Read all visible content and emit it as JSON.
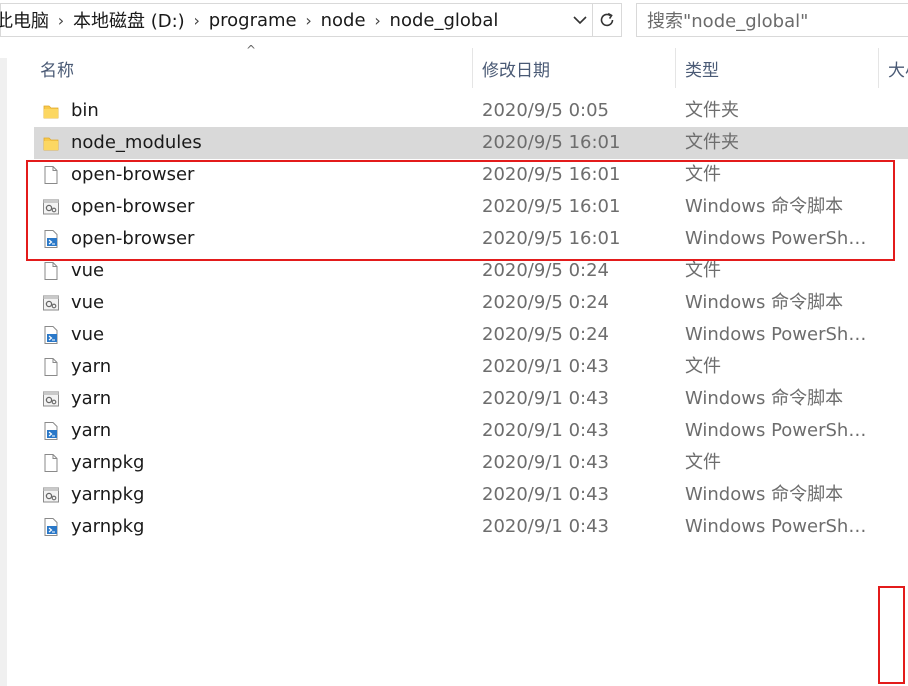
{
  "breadcrumb": {
    "items": [
      "此电脑",
      "本地磁盘 (D:)",
      "programe",
      "node",
      "node_global"
    ],
    "dropdown_icon": "chevron-down-icon",
    "refresh_icon": "refresh-icon"
  },
  "search": {
    "placeholder": "搜索\"node_global\""
  },
  "columns": {
    "name": "名称",
    "date": "修改日期",
    "type": "类型",
    "size": "大小"
  },
  "colors": {
    "highlight": "#e31b1b",
    "selected_row": "#d9d9d9",
    "folder": "#f8c94b"
  },
  "files": [
    {
      "name": "bin",
      "date": "2020/9/5 0:05",
      "type": "文件夹",
      "icon": "folder-icon"
    },
    {
      "name": "node_modules",
      "date": "2020/9/5 16:01",
      "type": "文件夹",
      "icon": "folder-icon",
      "selected": true
    },
    {
      "name": "open-browser",
      "date": "2020/9/5 16:01",
      "type": "文件",
      "icon": "file-icon"
    },
    {
      "name": "open-browser",
      "date": "2020/9/5 16:01",
      "type": "Windows 命令脚本",
      "icon": "cmd-script-icon"
    },
    {
      "name": "open-browser",
      "date": "2020/9/5 16:01",
      "type": "Windows PowerShell 脚本",
      "icon": "powershell-icon"
    },
    {
      "name": "vue",
      "date": "2020/9/5 0:24",
      "type": "文件",
      "icon": "file-icon"
    },
    {
      "name": "vue",
      "date": "2020/9/5 0:24",
      "type": "Windows 命令脚本",
      "icon": "cmd-script-icon"
    },
    {
      "name": "vue",
      "date": "2020/9/5 0:24",
      "type": "Windows PowerShell 脚本",
      "icon": "powershell-icon"
    },
    {
      "name": "yarn",
      "date": "2020/9/1 0:43",
      "type": "文件",
      "icon": "file-icon"
    },
    {
      "name": "yarn",
      "date": "2020/9/1 0:43",
      "type": "Windows 命令脚本",
      "icon": "cmd-script-icon"
    },
    {
      "name": "yarn",
      "date": "2020/9/1 0:43",
      "type": "Windows PowerShell 脚本",
      "icon": "powershell-icon"
    },
    {
      "name": "yarnpkg",
      "date": "2020/9/1 0:43",
      "type": "文件",
      "icon": "file-icon"
    },
    {
      "name": "yarnpkg",
      "date": "2020/9/1 0:43",
      "type": "Windows 命令脚本",
      "icon": "cmd-script-icon"
    },
    {
      "name": "yarnpkg",
      "date": "2020/9/1 0:43",
      "type": "Windows PowerShell 脚本",
      "icon": "powershell-icon"
    }
  ]
}
